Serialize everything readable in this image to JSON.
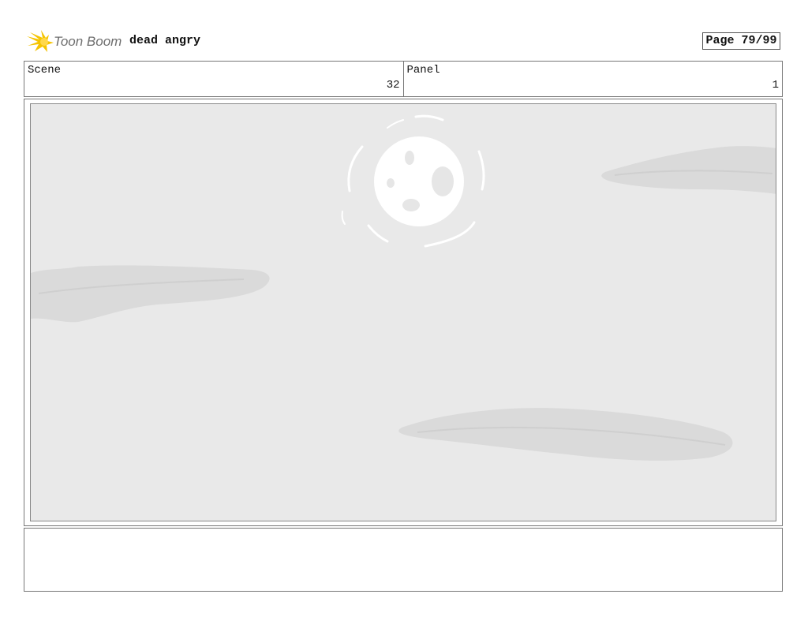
{
  "header": {
    "logo_text": "Toon Boom",
    "project_title": "dead angry",
    "page_counter": "Page 79/99"
  },
  "info": {
    "scene_label": "Scene",
    "scene_value": "32",
    "panel_label": "Panel",
    "panel_value": "1"
  },
  "notes": {
    "text": ""
  },
  "colors": {
    "logo_star": "#f5c400",
    "logo_text": "#6e6e6e",
    "sky": "#e9e9e9",
    "cloud": "#d6d6d6",
    "moon": "#ffffff"
  },
  "panel_image": {
    "icons": [
      "moon-icon",
      "cloud-icon"
    ]
  }
}
